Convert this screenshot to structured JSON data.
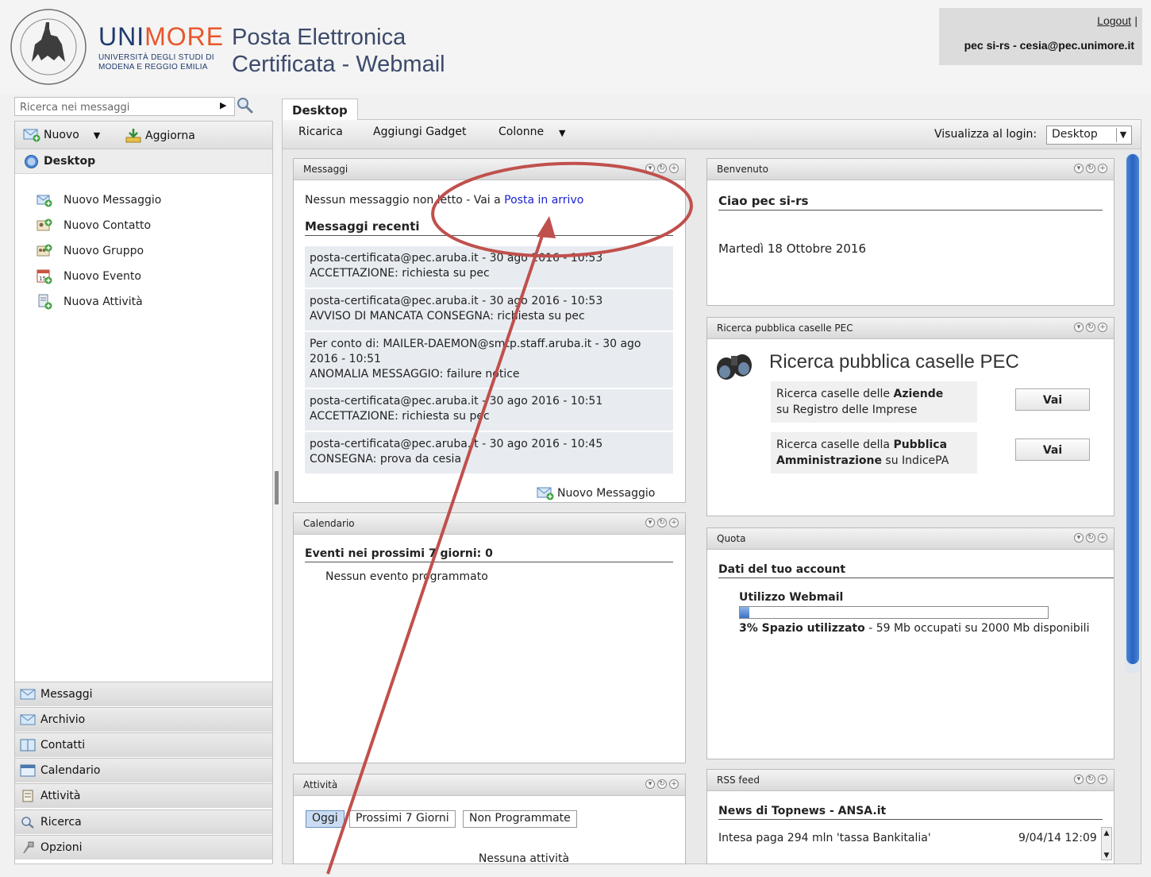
{
  "brand": {
    "name_part1": "UNI",
    "name_part2": "MORE",
    "sub_line1": "UNIVERSITÀ DEGLI STUDI DI",
    "sub_line2": "MODENA E REGGIO EMILIA",
    "app_title_line1": "Posta Elettronica",
    "app_title_line2": "Certificata - Webmail",
    "accent": "#e8572a",
    "navy": "#1f3a6e"
  },
  "user": {
    "logout": "Logout",
    "separator": "|",
    "name": "pec si-rs - cesia@pec.unimore.it"
  },
  "sidebar": {
    "search_placeholder": "Ricerca nei messaggi",
    "toolbar": {
      "new": "Nuovo",
      "refresh": "Aggiorna"
    },
    "desktop": "Desktop",
    "quick_links": [
      {
        "label": "Nuovo Messaggio",
        "icon": "new-message-icon"
      },
      {
        "label": "Nuovo Contatto",
        "icon": "new-contact-icon"
      },
      {
        "label": "Nuovo Gruppo",
        "icon": "new-group-icon"
      },
      {
        "label": "Nuovo Evento",
        "icon": "new-event-icon"
      },
      {
        "label": "Nuova Attività",
        "icon": "new-task-icon"
      }
    ],
    "nav": [
      {
        "label": "Messaggi",
        "icon": "envelope-icon"
      },
      {
        "label": "Archivio",
        "icon": "archive-icon"
      },
      {
        "label": "Contatti",
        "icon": "address-book-icon"
      },
      {
        "label": "Calendario",
        "icon": "calendar-icon"
      },
      {
        "label": "Attività",
        "icon": "tasks-icon"
      },
      {
        "label": "Ricerca",
        "icon": "search-icon"
      },
      {
        "label": "Opzioni",
        "icon": "tools-icon"
      }
    ]
  },
  "main": {
    "tab": "Desktop",
    "toolbar": {
      "reload": "Ricarica",
      "add_gadget": "Aggiungi Gadget",
      "columns": "Colonne",
      "login_view_label": "Visualizza al login:",
      "login_view_value": "Desktop"
    }
  },
  "messages_gadget": {
    "title": "Messaggi",
    "unread_text": "Nessun messaggio non letto - Vai a ",
    "inbox_link": "Posta in arrivo",
    "recent_heading": "Messaggi recenti",
    "items": [
      {
        "line1": "posta-certificata@pec.aruba.it - 30 ago 2016 - 10:53",
        "line2": "ACCETTAZIONE: richiesta su pec"
      },
      {
        "line1": "posta-certificata@pec.aruba.it - 30 ago 2016 - 10:53",
        "line2": "AVVISO DI MANCATA CONSEGNA: richiesta su pec"
      },
      {
        "line1": "Per conto di: MAILER-DAEMON@smtp.staff.aruba.it - 30 ago 2016 - 10:51",
        "line2": "ANOMALIA MESSAGGIO: failure notice"
      },
      {
        "line1": "posta-certificata@pec.aruba.it - 30 ago 2016 - 10:51",
        "line2": "ACCETTAZIONE: richiesta su pec"
      },
      {
        "line1": "posta-certificata@pec.aruba.it - 30 ago 2016 - 10:45",
        "line2": "CONSEGNA: prova da cesia"
      }
    ],
    "new_message": "Nuovo Messaggio"
  },
  "calendar_gadget": {
    "title": "Calendario",
    "heading": "Eventi nei prossimi 7 giorni: 0",
    "empty": "Nessun evento programmato"
  },
  "tasks_gadget": {
    "title": "Attività",
    "tabs": [
      "Oggi",
      "Prossimi 7 Giorni",
      "Non Programmate"
    ],
    "empty": "Nessuna attività"
  },
  "welcome_gadget": {
    "title": "Benvenuto",
    "greeting": "Ciao pec si-rs",
    "date": "Martedì 18 Ottobre 2016"
  },
  "pec_search_gadget": {
    "title": "Ricerca pubblica caselle PEC",
    "heading": "Ricerca pubblica caselle PEC",
    "row1_pre": "Ricerca caselle delle ",
    "row1_bold": "Aziende",
    "row1_post": "su Registro delle Imprese",
    "row2_pre": "Ricerca caselle della ",
    "row2_bold1": "Pubblica",
    "row2_bold2": "Amministrazione",
    "row2_post": " su IndicePA",
    "button": "Vai"
  },
  "quota_gadget": {
    "title": "Quota",
    "heading": "Dati del tuo account",
    "usage_heading": "Utilizzo Webmail",
    "usage_percent": 3,
    "usage_bold": "3% Spazio utilizzato",
    "usage_rest": " - 59 Mb occupati su 2000 Mb disponibili"
  },
  "rss_gadget": {
    "title": "RSS feed",
    "heading": "News di Topnews - ANSA.it",
    "items": [
      {
        "text": "Intesa paga 294 mln 'tassa Bankitalia'",
        "date": "9/04/14 12:09"
      }
    ]
  },
  "annotation_color": "#c0504d"
}
